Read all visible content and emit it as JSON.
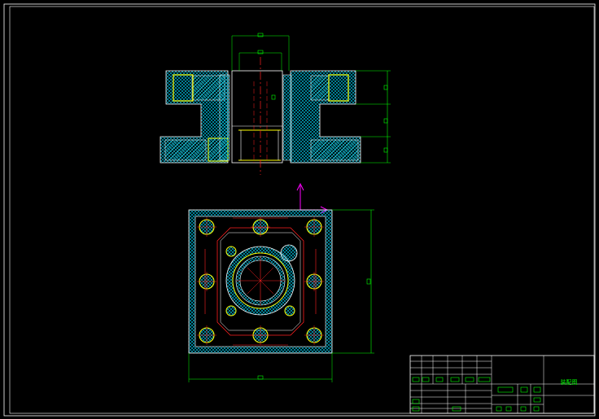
{
  "drawing": {
    "background": "#000000",
    "colors": {
      "outline": "#ffffff",
      "hatch": "#00d8ff",
      "solid": "#ffff00",
      "section_hatch": "#37d2dc",
      "center": "#ff2020",
      "dim": "#00ff00",
      "ucs": "#ff00ff"
    },
    "title_block": {
      "title": "装配图"
    }
  }
}
